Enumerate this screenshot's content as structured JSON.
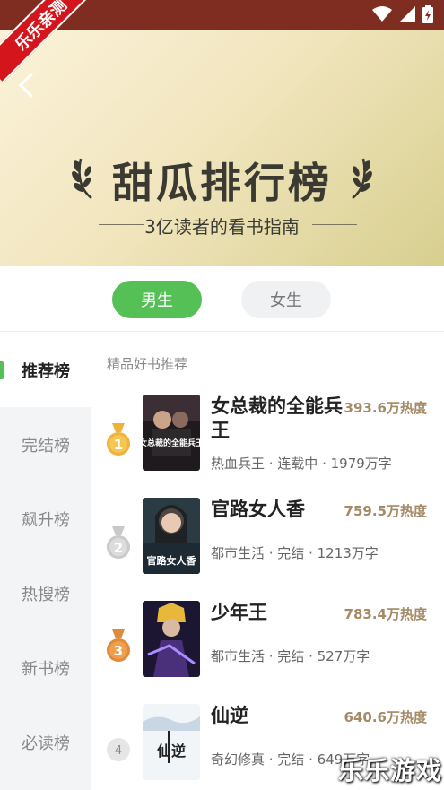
{
  "watermark_top": "乐乐亲测",
  "watermark_bottom": "乐乐游戏",
  "hero": {
    "title": "甜瓜排行榜",
    "subtitle": "3亿读者的看书指南"
  },
  "gender_tabs": [
    {
      "label": "男生",
      "active": true
    },
    {
      "label": "女生",
      "active": false
    }
  ],
  "sidebar": {
    "items": [
      {
        "label": "推荐榜",
        "active": true
      },
      {
        "label": "完结榜"
      },
      {
        "label": "飙升榜"
      },
      {
        "label": "热搜榜"
      },
      {
        "label": "新书榜"
      },
      {
        "label": "必读榜"
      }
    ]
  },
  "list": {
    "section_title": "精品好书推荐",
    "books": [
      {
        "rank": "1",
        "title": "女总裁的全能兵王",
        "hot": "393.6万热度",
        "meta": "热血兵王 · 连载中 · 1979万字",
        "cover_text": "女总裁的全能兵王",
        "rank_color": "#f0b23a"
      },
      {
        "rank": "2",
        "title": "官路女人香",
        "hot": "759.5万热度",
        "meta": "都市生活 · 完结 · 1213万字",
        "cover_text": "官路女人香",
        "rank_color": "#c9c9c9"
      },
      {
        "rank": "3",
        "title": "少年王",
        "hot": "783.4万热度",
        "meta": "都市生活 · 完结 · 527万字",
        "cover_text": "",
        "rank_color": "#e08a3a"
      },
      {
        "rank": "4",
        "title": "仙逆",
        "hot": "640.6万热度",
        "meta": "奇幻修真 · 完结 · 649万字",
        "cover_text": "仙逆",
        "rank_color": "#e6e6e6"
      }
    ]
  }
}
